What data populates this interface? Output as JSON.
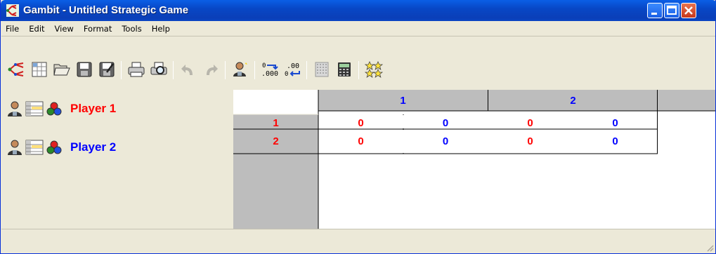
{
  "window": {
    "title": "Gambit - Untitled Strategic Game"
  },
  "menu": [
    "File",
    "Edit",
    "View",
    "Format",
    "Tools",
    "Help"
  ],
  "toolbar": {
    "icons": [
      "new-tree-icon",
      "new-table-icon",
      "open-icon",
      "save-icon",
      "save-as-icon",
      "print-icon",
      "print-preview-icon",
      "undo-icon",
      "redo-icon",
      "add-player-icon",
      "decimal-more-icon",
      "decimal-less-icon",
      "dominance-icon",
      "calculator-icon",
      "equilibria-icon"
    ]
  },
  "players": [
    {
      "name": "Player 1",
      "color": "#ff0000"
    },
    {
      "name": "Player 2",
      "color": "#0000ff"
    }
  ],
  "game": {
    "column_strategies": [
      "1",
      "2"
    ],
    "row_strategies": [
      "1",
      "2"
    ],
    "payoffs": [
      [
        [
          "0",
          "0"
        ],
        [
          "0",
          "0"
        ]
      ],
      [
        [
          "0",
          "0"
        ],
        [
          "0",
          "0"
        ]
      ]
    ]
  },
  "colors": {
    "player1": "#ff0000",
    "player2": "#0000ff",
    "header_gray": "#bdbdbd"
  }
}
